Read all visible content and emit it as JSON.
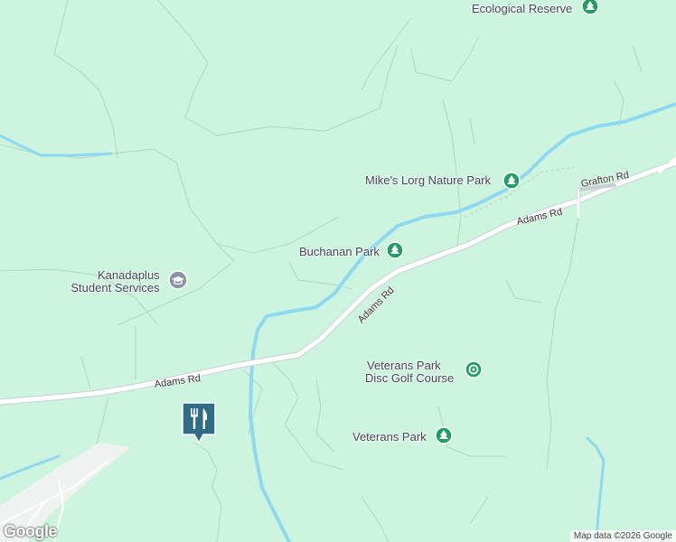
{
  "map": {
    "colors": {
      "land": "#cdf4de",
      "water": "#8ed9f0",
      "road": "#ffffff",
      "road_outline": "#c9d0d4",
      "trail": "#a9c9ba",
      "park_icon": "#1f9d62",
      "school_icon": "#8a96a3",
      "pin_bg": "#2f6d86"
    },
    "places": {
      "ecological_reserve": {
        "label": "Ecological Reserve",
        "icon": "tree-icon"
      },
      "mikes_lorg": {
        "label": "Mike's Lorg Nature Park",
        "icon": "tree-icon"
      },
      "buchanan": {
        "label": "Buchanan Park",
        "icon": "tree-icon"
      },
      "kanadaplus": {
        "line1": "Kanadaplus",
        "line2": "Student Services",
        "icon": "school-icon"
      },
      "veterans_disc": {
        "line1": "Veterans Park",
        "line2": "Disc Golf Course",
        "icon": "target-icon"
      },
      "veterans": {
        "label": "Veterans Park",
        "icon": "tree-icon"
      }
    },
    "roads": {
      "grafton": "Grafton Rd",
      "adams_east": "Adams Rd",
      "adams_diag": "Adams Rd",
      "adams_west": "Adams Rd"
    },
    "pin": {
      "icon": "restaurant-icon"
    },
    "footer": {
      "logo": "Google",
      "copyright": "Map data ©2026 Google"
    }
  }
}
